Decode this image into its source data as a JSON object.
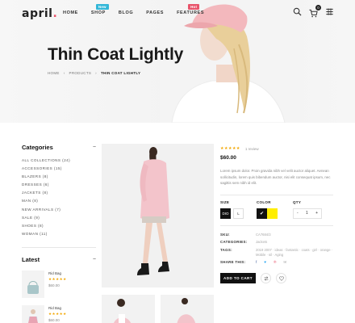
{
  "brand": {
    "name": "april",
    "dot": "."
  },
  "nav": [
    {
      "label": "HOME",
      "badge": null
    },
    {
      "label": "SHOP",
      "badge": "New"
    },
    {
      "label": "BLOG",
      "badge": null
    },
    {
      "label": "PAGES",
      "badge": null
    },
    {
      "label": "FEATURES",
      "badge": "Hot"
    }
  ],
  "header": {
    "cart_count": "0"
  },
  "hero": {
    "title": "Thin Coat Lightly"
  },
  "breadcrumb": {
    "home": "HOME",
    "products": "PRODUCTS",
    "current": "THIN COAT LIGHTLY"
  },
  "sidebar": {
    "categories_title": "Categories",
    "categories": [
      "ALL COLLECTIONS (24)",
      "ACCESSORIES (15)",
      "BLAZERS (8)",
      "DRESSES (6)",
      "JACKETS (8)",
      "MAN (8)",
      "NEW ARRIVALS (7)",
      "SALE (9)",
      "SHOES (8)",
      "WOMAN (11)"
    ],
    "latest_title": "Latest",
    "latest": [
      {
        "name": "Rid Bag",
        "stars": "★★★★★",
        "price": "$60.00"
      },
      {
        "name": "Rid Bag",
        "stars": "★★★★★",
        "price": "$60.00"
      }
    ]
  },
  "product": {
    "stars": "★★★★★",
    "reviews": "1 review",
    "price": "$60.00",
    "description": "Lorem ipsum dolor. Proin gravida nibh vel velit auctor aliquet. Aenean sollicitudin, lorem quis bibendum auctor, nisi elit consequat ipsum, nec sagittis sem nibh id elit.",
    "size_label": "SIZE",
    "sizes": [
      "DIO",
      "L"
    ],
    "color_label": "COLOR",
    "colors": [
      "#111111",
      "#ffee00"
    ],
    "qty_label": "QTY",
    "qty_minus": "-",
    "qty_value": "1",
    "qty_plus": "+",
    "sku_label": "SKU:",
    "sku_value": "CA7684/3",
    "categories_label": "CATEGORIES:",
    "categories_value": "Jackets",
    "tags_label": "TAGS:",
    "tags_value": "2019 2007 · ideas · fantastic · coats · girl · orange · Mobile · sil · Aging",
    "share_label": "SHARE THIS:",
    "share_icons": [
      "f",
      "♥",
      "℗",
      "✉"
    ],
    "add_to_cart": "ADD TO CART"
  }
}
